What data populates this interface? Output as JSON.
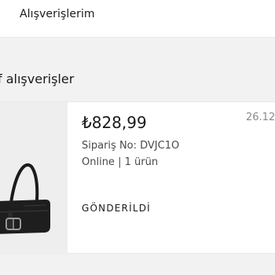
{
  "header": {
    "title": "Alışverişlerim"
  },
  "section": {
    "heading": "f alışverişler"
  },
  "order": {
    "price": "₺828,99",
    "date": "26.12.",
    "order_number": "Sipariş No: DVJC1O",
    "channel": "Online",
    "separator": " | ",
    "item_count": "1 ürün",
    "status": "GÖNDERİLDİ",
    "product_image": "black-shoulder-bag"
  },
  "colors": {
    "page_background": "#f2f2f2",
    "card_background": "#ffffff",
    "text_primary": "#1a1a1a",
    "text_secondary": "#4a4a4a",
    "text_muted": "#8a8a8a"
  }
}
